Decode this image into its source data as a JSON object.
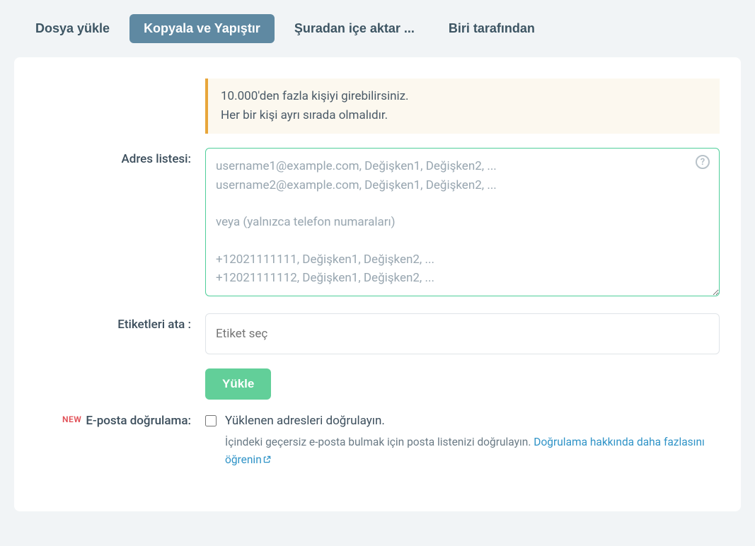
{
  "tabs": {
    "upload": "Dosya yükle",
    "paste": "Kopyala ve Yapıştır",
    "import": "Şuradan içe aktar ...",
    "by": "Biri tarafından"
  },
  "info": {
    "line1": "10.000'den fazla kişiyi girebilirsiniz.",
    "line2": "Her bir kişi ayrı sırada olmalıdır."
  },
  "addressList": {
    "label": "Adres listesi:",
    "placeholder": "username1@example.com, Değişken1, Değişken2, ...\nusername2@example.com, Değişken1, Değişken2, ...\n\nveya (yalnızca telefon numaraları)\n\n+12021111111, Değişken1, Değişken2, ...\n+12021111112, Değişken1, Değişken2, ...",
    "value": ""
  },
  "tags": {
    "label": "Etiketleri ata :",
    "placeholder": "Etiket seç"
  },
  "upload": {
    "button": "Yükle"
  },
  "verify": {
    "newBadge": "NEW",
    "label": "E-posta doğrulama:",
    "checkboxLabel": "Yüklenen adresleri doğrulayın.",
    "descPrefix": "İçindeki geçersiz e-posta bulmak için posta listenizi doğrulayın. ",
    "linkText": "Doğrulama hakkında daha fazlasını öğrenin"
  },
  "icons": {
    "help": "?"
  }
}
